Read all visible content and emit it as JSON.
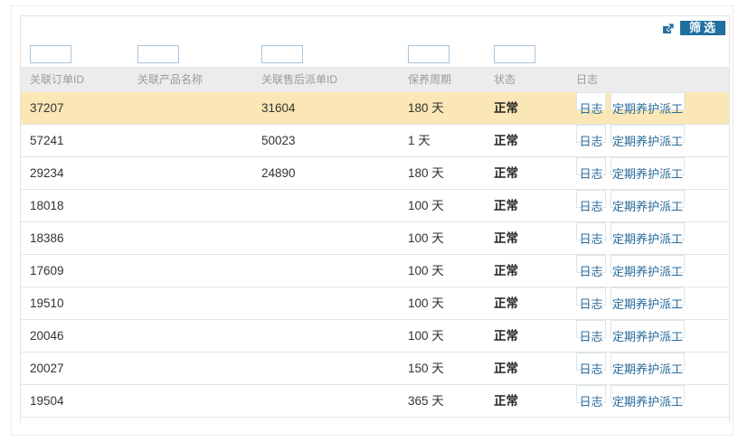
{
  "toolbar": {
    "filter_label": "筛选",
    "filter_icon": "export-arrow-icon"
  },
  "columns": [
    "关联订单ID",
    "关联产品名称",
    "关联售后派单ID",
    "保养周期",
    "状态",
    "日志"
  ],
  "rows": [
    {
      "order_id": "37207",
      "product_name": "",
      "after_sale_id": "31604",
      "cycle": "180 天",
      "status": "正常",
      "log_label": "日志",
      "dispatch_label": "定期养护派工"
    },
    {
      "order_id": "57241",
      "product_name": "",
      "after_sale_id": "50023",
      "cycle": "1 天",
      "status": "正常",
      "log_label": "日志",
      "dispatch_label": "定期养护派工"
    },
    {
      "order_id": "29234",
      "product_name": "",
      "after_sale_id": "24890",
      "cycle": "180 天",
      "status": "正常",
      "log_label": "日志",
      "dispatch_label": "定期养护派工"
    },
    {
      "order_id": "18018",
      "product_name": "",
      "after_sale_id": "",
      "cycle": "100 天",
      "status": "正常",
      "log_label": "日志",
      "dispatch_label": "定期养护派工"
    },
    {
      "order_id": "18386",
      "product_name": "",
      "after_sale_id": "",
      "cycle": "100 天",
      "status": "正常",
      "log_label": "日志",
      "dispatch_label": "定期养护派工"
    },
    {
      "order_id": "17609",
      "product_name": "",
      "after_sale_id": "",
      "cycle": "100 天",
      "status": "正常",
      "log_label": "日志",
      "dispatch_label": "定期养护派工"
    },
    {
      "order_id": "19510",
      "product_name": "",
      "after_sale_id": "",
      "cycle": "100 天",
      "status": "正常",
      "log_label": "日志",
      "dispatch_label": "定期养护派工"
    },
    {
      "order_id": "20046",
      "product_name": "",
      "after_sale_id": "",
      "cycle": "100 天",
      "status": "正常",
      "log_label": "日志",
      "dispatch_label": "定期养护派工"
    },
    {
      "order_id": "20027",
      "product_name": "",
      "after_sale_id": "",
      "cycle": "150 天",
      "status": "正常",
      "log_label": "日志",
      "dispatch_label": "定期养护派工"
    },
    {
      "order_id": "19504",
      "product_name": "",
      "after_sale_id": "",
      "cycle": "365 天",
      "status": "正常",
      "log_label": "日志",
      "dispatch_label": "定期养护派工"
    }
  ],
  "colors": {
    "accent": "#1f6f9f",
    "highlight_row": "#fbe7b5",
    "header_bg": "#ececec"
  }
}
